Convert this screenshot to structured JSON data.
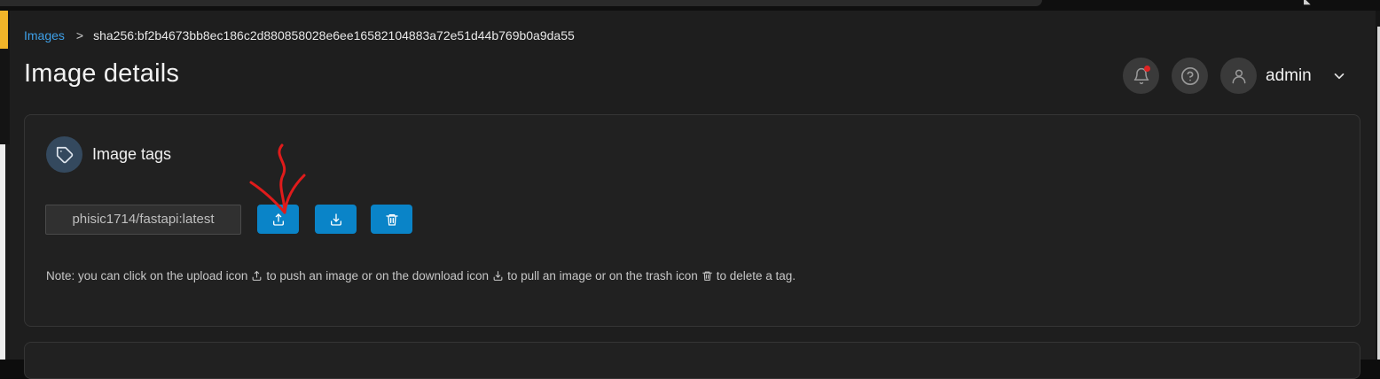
{
  "breadcrumb": {
    "parent": "Images",
    "separator": ">",
    "current": "sha256:bf2b4673bb8ec186c2d880858028e6ee16582104883a72e51d44b769b0a9da55"
  },
  "page": {
    "title": "Image details"
  },
  "header": {
    "user_name": "admin",
    "icons": {
      "notifications": "bell-icon",
      "help": "help-circle-icon",
      "user": "user-icon",
      "menu": "chevron-down-icon"
    }
  },
  "image_tags": {
    "title": "Image tags",
    "title_icon": "tag-icon",
    "tag": "phisic1714/fastapi:latest",
    "buttons": {
      "push": "upload-icon",
      "pull": "download-icon",
      "delete": "trash-icon"
    },
    "note": {
      "part1": "Note: you can click on the upload icon",
      "part2": "to push an image or on the download icon",
      "part3": "to pull an image or on the trash icon",
      "part4": "to delete a tag."
    }
  },
  "colors": {
    "accent_blue": "#0a84c8",
    "link_blue": "#3ea0e8",
    "background": "#1e1e1e",
    "card": "#212121",
    "annotation_red": "#e01b1b",
    "notification_dot": "#e02424",
    "sidebar_accent": "#f0b429"
  }
}
